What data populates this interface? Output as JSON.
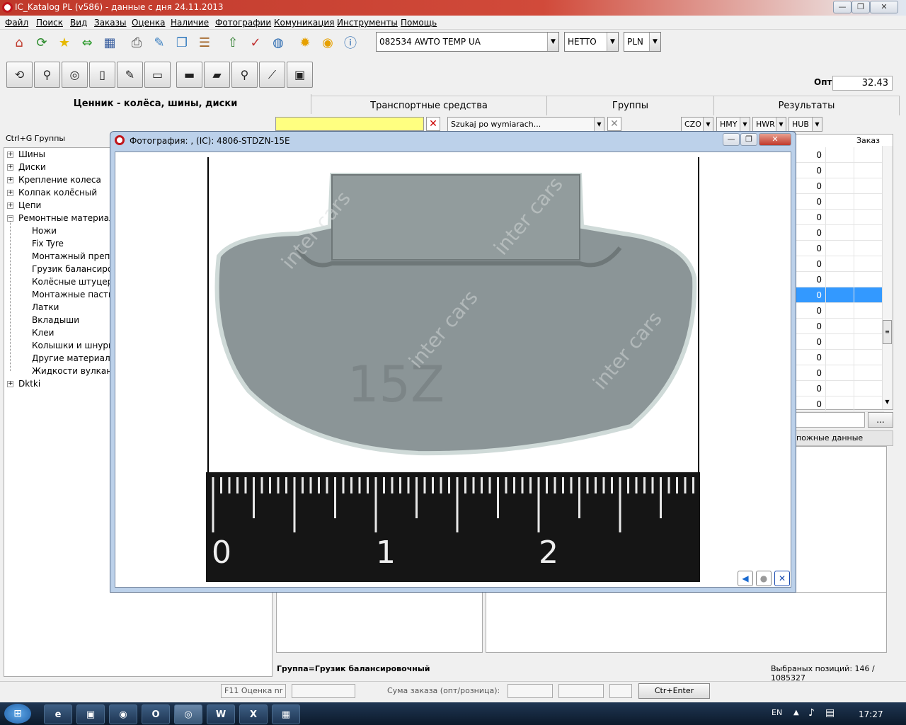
{
  "window": {
    "title": "IC_Katalog PL (v586) - данные с дня 24.11.2013"
  },
  "menu": [
    "Файл",
    "Поиск",
    "Вид",
    "Заказы",
    "Оценка",
    "Наличие",
    "Фотографии",
    "Комуникация",
    "Инструменты",
    "Помощь"
  ],
  "toolbar": {
    "client": "082534  AWTO TEMP UA",
    "price_type": "НЕТТО",
    "currency": "PLN"
  },
  "opt": {
    "label": "Опт:",
    "value": "32.43"
  },
  "tabs": [
    "Ценник - колёса, шины, диски",
    "Транспортные средства",
    "Группы",
    "Результаты"
  ],
  "tree": {
    "hint": "Ctrl+G Группы",
    "top_items": [
      "Шины",
      "Диски",
      "Крепление колеса",
      "Колпак колёсный",
      "Цепи",
      "Ремонтные материалы"
    ],
    "sub_items": [
      "Ножи",
      "Fix Tyre",
      "Монтажный препарат",
      "Грузик балансировочный",
      "Колёсные штуцера",
      "Монтажные пасты",
      "Латки",
      "Вкладыши",
      "Клеи",
      "Колышки и шнуры",
      "Другие материалы",
      "Жидкости вулканиз"
    ],
    "last_item": "Dktki"
  },
  "filters": {
    "search_placeholder": "Szukaj po wymiarach...",
    "czo": "CZO",
    "hmy": "HMY",
    "hwr": "HWR",
    "hub": "HUB"
  },
  "grid": {
    "header_order": "Заказ",
    "values": [
      "0",
      "0",
      "0",
      "0",
      "0",
      "0",
      "0",
      "0",
      "0",
      "0",
      "0",
      "0",
      "0",
      "0",
      "0",
      "0",
      "0"
    ],
    "selected_index": 9,
    "more": "...",
    "footer_label": "пожные данные"
  },
  "photo": {
    "title": "Фотография: , (IC): 4806-STDZN-15E",
    "ruler": [
      "0",
      "1",
      "2"
    ],
    "watermark": "inter cars",
    "stamp": "15Z"
  },
  "bottom": {
    "group": "Группа=Грузик балансировочный",
    "selected": "Выбраных позиций: 146 / 1085327"
  },
  "status": {
    "f11": "F11 Оценка nr",
    "sum": "Сума заказа (опт/розница):",
    "enter": "Ctr+Enter закажи"
  },
  "taskbar": {
    "lang": "EN",
    "time": "17:27"
  },
  "colors": {
    "accent": "#c0151b",
    "selection": "#3399ff"
  }
}
